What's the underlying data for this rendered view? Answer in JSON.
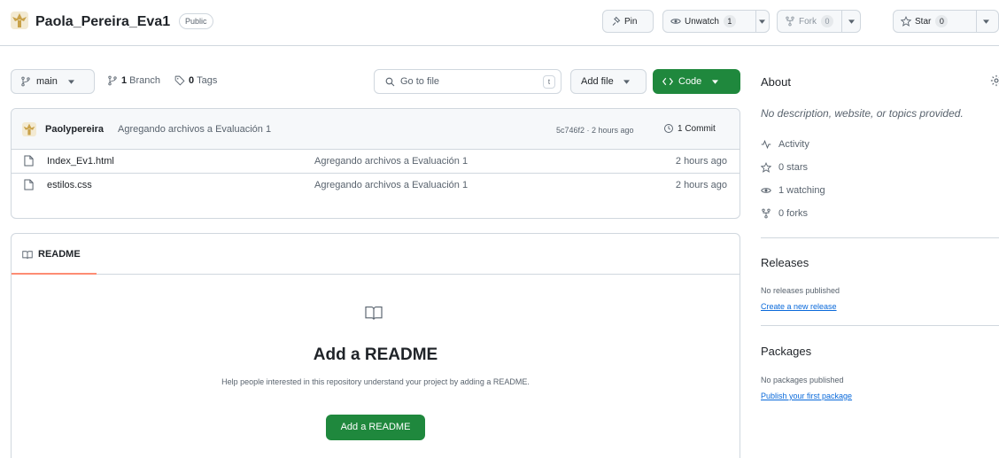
{
  "repo": {
    "name": "Paola_Pereira_Eva1",
    "visibility": "Public"
  },
  "header_actions": {
    "pin_label": "Pin",
    "unwatch_label": "Unwatch",
    "watch_count": "1",
    "fork_label": "Fork",
    "fork_count": "0",
    "star_label": "Star",
    "star_count": "0"
  },
  "toolbar": {
    "branch": "main",
    "branches_count": "1",
    "branches_label": "Branch",
    "tags_count": "0",
    "tags_label": "Tags",
    "search_placeholder": "Go to file",
    "search_shortcut": "t",
    "add_file_label": "Add file",
    "code_label": "Code"
  },
  "latest_commit": {
    "author": "Paolypereira",
    "message": "Agregando archivos a Evaluación 1",
    "hash": "5c746f2",
    "time": "2 hours ago",
    "hash_time": "5c746f2 · 2 hours ago",
    "commits_label": "1 Commit"
  },
  "files": [
    {
      "name": "Index_Ev1.html",
      "message": "Agregando archivos a Evaluación 1",
      "time": "2 hours ago"
    },
    {
      "name": "estilos.css",
      "message": "Agregando archivos a Evaluación 1",
      "time": "2 hours ago"
    }
  ],
  "readme": {
    "tab_label": "README",
    "title": "Add a README",
    "description": "Help people interested in this repository understand your project by adding a README.",
    "button_label": "Add a README"
  },
  "about": {
    "heading": "About",
    "description": "No description, website, or topics provided.",
    "activity_label": "Activity",
    "stars_label": "0 stars",
    "watching_label": "1 watching",
    "forks_label": "0 forks"
  },
  "releases": {
    "heading": "Releases",
    "empty_text": "No releases published",
    "link_label": "Create a new release"
  },
  "packages": {
    "heading": "Packages",
    "empty_text": "No packages published",
    "link_label": "Publish your first package"
  },
  "colors": {
    "accent_green": "#1f883d",
    "link_blue": "#0969da",
    "border": "#d0d7de",
    "tab_underline": "#fd8c73"
  }
}
